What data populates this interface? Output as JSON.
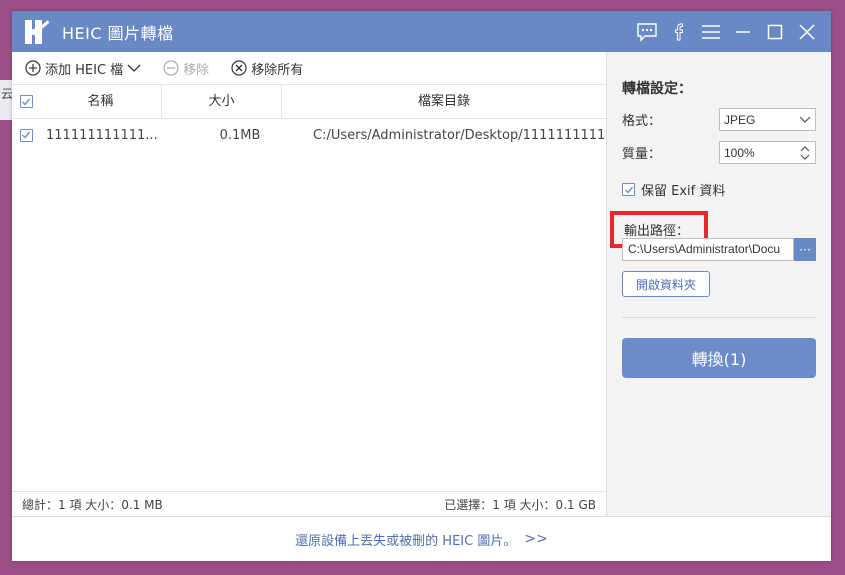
{
  "background": {
    "left_edge_text": "云"
  },
  "window": {
    "title": "HEIC 圖片轉檔",
    "controls": [
      "feedback-icon",
      "facebook-icon",
      "menu-icon",
      "minimize-icon",
      "maximize-icon",
      "close-icon"
    ]
  },
  "toolbar": {
    "add_label": "添加 HEIC 檔",
    "remove_label": "移除",
    "remove_all_label": "移除所有"
  },
  "table": {
    "columns": [
      "名稱",
      "大小",
      "檔案目錄"
    ],
    "rows": [
      {
        "name": "111111111111...",
        "size": "0.1MB",
        "path": "C:/Users/Administrator/Desktop/111111111111..."
      }
    ]
  },
  "status": {
    "total": "總計：1 項 大小：0.1 MB",
    "selected": "已選擇：1 項 大小：0.1 GB"
  },
  "settings": {
    "title": "轉檔設定：",
    "format_label": "格式：",
    "format_value": "JPEG",
    "quality_label": "質量：",
    "quality_value": "100%",
    "exif_label": "保留 Exif 資料",
    "output_label": "輸出路徑：",
    "output_path": "C:\\Users\\Administrator\\Docu",
    "browse_label": "···",
    "open_folder_label": "開啟資料夾",
    "convert_label": "轉換(1)"
  },
  "footer": {
    "link_text": "還原設備上丟失或被刪的 HEIC 圖片。",
    "arrow": ">>"
  },
  "colors": {
    "titlebar": "#6889c4",
    "accent": "#6b8cc8",
    "highlight_box": "#e5262b",
    "desktop": "#9a4f86"
  }
}
